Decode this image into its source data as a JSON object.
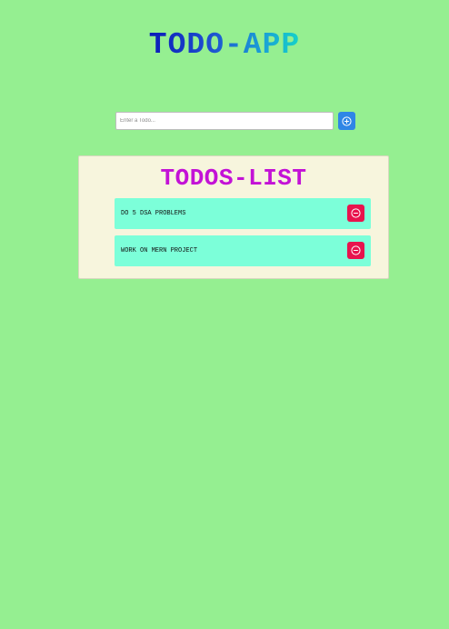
{
  "header": {
    "title": "TODO-APP"
  },
  "input": {
    "placeholder": "Enter a Todo...",
    "value": "",
    "add_icon": "plus-circle-icon"
  },
  "list": {
    "title": "TODOS-LIST",
    "items": [
      {
        "text": "DO 5 DSA PROBLEMS",
        "delete_icon": "minus-circle-icon"
      },
      {
        "text": "WORK ON MERN PROJECT",
        "delete_icon": "minus-circle-icon"
      }
    ]
  },
  "colors": {
    "background": "#95ef91",
    "card": "#f7f5dd",
    "item": "#7cffd9",
    "list_title": "#c312d6",
    "add_button": "#2f86e6",
    "delete_button": "#e8134d"
  }
}
